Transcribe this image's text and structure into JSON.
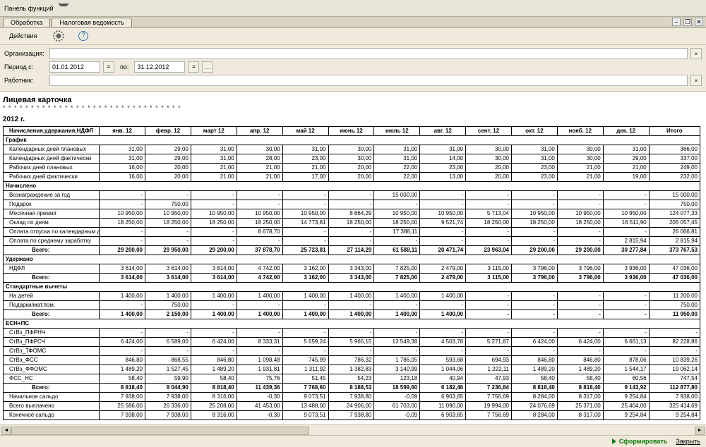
{
  "panel": {
    "title": "Панель функций"
  },
  "tabs": {
    "processing": "Обработка",
    "report": "Налоговая ведомость"
  },
  "window": {
    "minimize": "–",
    "restore": "❐",
    "close": "✕"
  },
  "toolbar": {
    "actions": "Действия",
    "gear_title": "Настройка",
    "help_title": "Справка"
  },
  "form": {
    "org_label": "Организация:",
    "period_label": "Период с:",
    "period_from": "01.01.2012",
    "period_to_label": "по:",
    "period_to": "31.12.2012",
    "worker_label": "Работник:",
    "clear": "×",
    "cal": "⌗",
    "pick": "…"
  },
  "doc": {
    "title": "Лицевая карточка",
    "stars": "* * * * * * * * * * * * * * * * * * * * * * * * * * * * * * * *",
    "year": "2012 г."
  },
  "columns": [
    "Начисления,удержания,НДФЛ",
    "янв. 12",
    "февр. 12",
    "март 12",
    "апр. 12",
    "май 12",
    "июнь 12",
    "июль 12",
    "авг. 12",
    "сент. 12",
    "окт. 12",
    "нояб. 12",
    "дек. 12",
    "Итого"
  ],
  "sections": {
    "grafik": "График",
    "nachisleno": "Начислено",
    "uderzhano": "Удержано",
    "std": "Стандартные вычеты",
    "esn": "ЕСН+ПС"
  },
  "rows": {
    "g1": {
      "l": "Календарных дней плановых",
      "v": [
        "31,00",
        "29,00",
        "31,00",
        "30,00",
        "31,00",
        "30,00",
        "31,00",
        "31,00",
        "30,00",
        "31,00",
        "30,00",
        "31,00",
        "366,00"
      ]
    },
    "g2": {
      "l": "Календарных дней фактически",
      "v": [
        "31,00",
        "29,00",
        "31,00",
        "28,00",
        "23,00",
        "30,00",
        "31,00",
        "14,00",
        "30,00",
        "31,00",
        "30,00",
        "29,00",
        "337,00"
      ]
    },
    "g3": {
      "l": "Рабочих дней плановых",
      "v": [
        "16,00",
        "20,00",
        "21,00",
        "21,00",
        "21,00",
        "20,00",
        "22,00",
        "23,00",
        "20,00",
        "23,00",
        "21,00",
        "21,00",
        "249,00"
      ]
    },
    "g4": {
      "l": "Рабочих дней фактически",
      "v": [
        "16,00",
        "20,00",
        "21,00",
        "21,00",
        "17,00",
        "20,00",
        "22,00",
        "13,00",
        "20,00",
        "23,00",
        "21,00",
        "19,00",
        "232,00"
      ]
    },
    "n1": {
      "l": "Вознаграждение за год",
      "v": [
        "-",
        "-",
        "-",
        "-",
        "-",
        "-",
        "15 000,00",
        "-",
        "-",
        "-",
        "-",
        "-",
        "15 000,00"
      ]
    },
    "n2": {
      "l": "Подарок",
      "v": [
        "-",
        "750,00",
        "-",
        "-",
        "-",
        "-",
        "-",
        "-",
        "-",
        "-",
        "-",
        "-",
        "750,00"
      ]
    },
    "n3": {
      "l": "Месячная премия",
      "v": [
        "10 950,00",
        "10 950,00",
        "10 950,00",
        "10 950,00",
        "10 950,00",
        "8 864,29",
        "10 950,00",
        "10 950,00",
        "5 713,04",
        "10 950,00",
        "10 950,00",
        "10 950,00",
        "124 077,33"
      ]
    },
    "n4": {
      "l": "Оклад по дням",
      "v": [
        "18 250,00",
        "18 250,00",
        "18 250,00",
        "18 250,00",
        "14 773,81",
        "18 250,00",
        "18 250,00",
        "9 521,74",
        "18 250,00",
        "18 250,00",
        "18 250,00",
        "16 511,90",
        "205 057,45"
      ]
    },
    "n5": {
      "l": "Оплата отпуска по календарным дням",
      "v": [
        "-",
        "-",
        "-",
        "8 678,70",
        "-",
        "-",
        "17 388,11",
        "-",
        "-",
        "-",
        "-",
        "-",
        "26 066,81"
      ]
    },
    "n6": {
      "l": "Оплата по среднему заработку",
      "v": [
        "-",
        "-",
        "-",
        "-",
        "-",
        "-",
        "-",
        "-",
        "-",
        "-",
        "-",
        "2 815,94",
        "2 815,94"
      ]
    },
    "nt": {
      "l": "Всего:",
      "v": [
        "29 200,00",
        "29 950,00",
        "29 200,00",
        "37 878,70",
        "25 723,81",
        "27 114,29",
        "61 588,11",
        "20 471,74",
        "23 963,04",
        "29 200,00",
        "29 200,00",
        "30 277,84",
        "373 767,53"
      ]
    },
    "u1": {
      "l": "НДФЛ",
      "v": [
        "3 614,00",
        "3 614,00",
        "3 614,00",
        "4 742,00",
        "3 162,00",
        "3 343,00",
        "7 825,00",
        "2 479,00",
        "3 115,00",
        "3 796,00",
        "3 796,00",
        "3 936,00",
        "47 036,00"
      ]
    },
    "ut": {
      "l": "Всего:",
      "v": [
        "3 614,00",
        "3 614,00",
        "3 614,00",
        "4 742,00",
        "3 162,00",
        "3 343,00",
        "7 825,00",
        "2 479,00",
        "3 115,00",
        "3 796,00",
        "3 796,00",
        "3 936,00",
        "47 036,00"
      ]
    },
    "s1": {
      "l": "На детей",
      "v": [
        "1 400,00",
        "1 400,00",
        "1 400,00",
        "1 400,00",
        "1 400,00",
        "1 400,00",
        "1 400,00",
        "1 400,00",
        "-",
        "-",
        "-",
        "-",
        "11 200,00"
      ]
    },
    "s2": {
      "l": "Подарки/мат.пом.",
      "v": [
        "-",
        "750,00",
        "-",
        "-",
        "-",
        "-",
        "-",
        "-",
        "-",
        "-",
        "-",
        "-",
        "750,00"
      ]
    },
    "st": {
      "l": "Всего:",
      "v": [
        "1 400,00",
        "2 150,00",
        "1 400,00",
        "1 400,00",
        "1 400,00",
        "1 400,00",
        "1 400,00",
        "1 400,00",
        "-",
        "-",
        "-",
        "-",
        "11 950,00"
      ]
    },
    "e1": {
      "l": "СтВз_ПФРНЧ",
      "v": [
        "-",
        "-",
        "-",
        "-",
        "-",
        "-",
        "-",
        "-",
        "-",
        "-",
        "-",
        "-",
        "-"
      ]
    },
    "e2": {
      "l": "СтВз_ПФРСЧ",
      "v": [
        "6 424,00",
        "6 589,00",
        "6 424,00",
        "8 333,31",
        "5 659,24",
        "5 965,15",
        "13 549,38",
        "4 503,78",
        "5 271,87",
        "6 424,00",
        "6 424,00",
        "6 661,13",
        "82 228,86"
      ]
    },
    "e3": {
      "l": "СтВз_ТФОМС",
      "v": [
        "-",
        "-",
        "-",
        "-",
        "-",
        "-",
        "-",
        "-",
        "-",
        "-",
        "-",
        "-",
        "-"
      ]
    },
    "e4": {
      "l": "СтВз_ФСС",
      "v": [
        "846,80",
        "868,55",
        "846,80",
        "1 098,48",
        "745,99",
        "786,32",
        "1 786,05",
        "593,68",
        "694,93",
        "846,80",
        "846,80",
        "878,06",
        "10 839,26"
      ]
    },
    "e5": {
      "l": "СтВз_ФФОМС",
      "v": [
        "1 489,20",
        "1 527,45",
        "1 489,20",
        "1 931,81",
        "1 311,92",
        "1 382,83",
        "3 140,99",
        "1 044,06",
        "1 222,11",
        "1 489,20",
        "1 489,20",
        "1 544,17",
        "19 062,14"
      ]
    },
    "e6": {
      "l": "ФСС_НС",
      "v": [
        "58,40",
        "59,90",
        "58,40",
        "75,76",
        "51,45",
        "54,23",
        "123,18",
        "40,94",
        "47,93",
        "58,40",
        "58,40",
        "60,56",
        "747,54"
      ]
    },
    "et": {
      "l": "Всего:",
      "v": [
        "8 818,40",
        "9 044,90",
        "8 818,40",
        "11 439,36",
        "7 768,60",
        "8 188,53",
        "18 599,60",
        "6 182,46",
        "7 236,84",
        "8 818,40",
        "8 818,40",
        "9 143,92",
        "112 877,80"
      ]
    },
    "b1": {
      "l": "Начальное сальдо",
      "v": [
        "7 938,00",
        "7 938,00",
        "8 316,00",
        "-0,30",
        "9 073,51",
        "7 938,80",
        "-0,09",
        "6 903,65",
        "7 756,69",
        "8 284,00",
        "8 317,00",
        "9 254,84",
        "7 938,00"
      ]
    },
    "b2": {
      "l": "Всего выплачено",
      "v": [
        "25 586,00",
        "26 336,00",
        "25 208,00",
        "41 453,00",
        "13 488,00",
        "24 906,00",
        "61 703,00",
        "11 090,00",
        "19 994,00",
        "24 076,69",
        "25 371,00",
        "25 404,00",
        "325 414,69"
      ]
    },
    "b3": {
      "l": "Конечное сальдо",
      "v": [
        "7 938,00",
        "7 938,00",
        "8 316,00",
        "-0,30",
        "9 073,51",
        "7 938,80",
        "-0,09",
        "6 903,65",
        "7 756,69",
        "8 284,00",
        "8 317,00",
        "9 254,84",
        "9 254,84"
      ]
    }
  },
  "footer": {
    "run": "Сформировать",
    "close": "Закрыть"
  }
}
